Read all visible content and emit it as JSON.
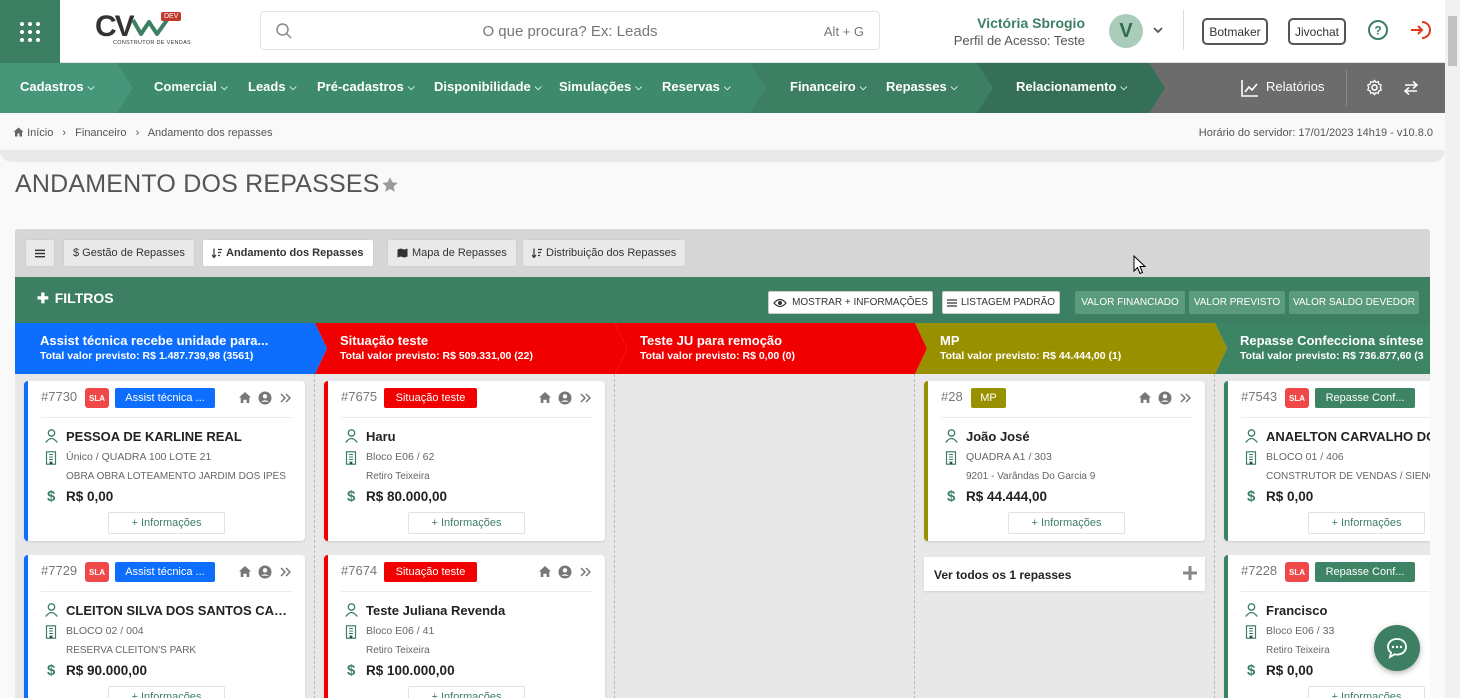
{
  "header": {
    "logo_text": "CV",
    "logo_badge": "DEV",
    "logo_subtitle": "CONSTRUTOR DE VENDAS",
    "search_placeholder": "O que procura? Ex: Leads",
    "search_shortcut": "Alt + G",
    "user_name": "Victória Sbrogio",
    "user_profile": "Perfil de Acesso: Teste",
    "avatar_initial": "V",
    "botmaker_label": "Botmaker",
    "jivochat_label": "Jivochat"
  },
  "nav": {
    "items": [
      "Cadastros",
      "Comercial",
      "Leads",
      "Pré-cadastros",
      "Disponibilidade",
      "Simulações",
      "Reservas",
      "Financeiro",
      "Repasses",
      "Relacionamento"
    ],
    "reports_label": "Relatórios"
  },
  "breadcrumb": {
    "items": [
      "Início",
      "Financeiro",
      "Andamento dos repasses"
    ]
  },
  "server_time": "Horário do servidor: 17/01/2023 14h19 - v10.8.0",
  "page_title": "ANDAMENTO DOS REPASSES",
  "tabs": [
    {
      "label": "$ Gestão de Repasses"
    },
    {
      "label": "Andamento dos Repasses"
    },
    {
      "label": "Mapa de Repasses"
    },
    {
      "label": "Distribuição dos Repasses"
    }
  ],
  "filters": {
    "label": "FILTROS",
    "show_more": "MOSTRAR + INFORMAÇÕES",
    "default_list": "LISTAGEM PADRÃO",
    "valor_financiado": "VALOR FINANCIADO",
    "valor_previsto": "VALOR PREVISTO",
    "valor_saldo": "VALOR SALDO DEVEDOR"
  },
  "columns": [
    {
      "title": "Assist técnica recebe unidade para...",
      "total": "Total valor previsto: R$ 1.487.739,98 (3561)",
      "color": "#0d6efd"
    },
    {
      "title": "Situação teste",
      "total": "Total valor previsto: R$ 509.331,00 (22)",
      "color": "#f00000"
    },
    {
      "title": "Teste JU para remoção",
      "total": "Total valor previsto: R$ 0,00 (0)",
      "color": "#f00000"
    },
    {
      "title": "MP",
      "total": "Total valor previsto: R$ 44.444,00 (1)",
      "color": "#999000"
    },
    {
      "title": "Repasse Confecciona síntese",
      "total": "Total valor previsto: R$ 736.877,60 (3",
      "color": "#3d8464"
    }
  ],
  "cards": [
    {
      "id": "#7730",
      "sla": "SLA",
      "badge": "Assist técnica ...",
      "name": "PESSOA DE KARLINE REAL",
      "unit": "Único / QUADRA 100 LOTE 21",
      "project": "OBRA OBRA LOTEAMENTO JARDIM DOS IPÊS",
      "value": "R$ 0,00",
      "more": "+ Informações"
    },
    {
      "id": "#7729",
      "sla": "SLA",
      "badge": "Assist técnica ...",
      "name": "CLEITON SILVA DOS SANTOS CARDOSO",
      "unit": "BLOCO 02 / 004",
      "project": "RESERVA CLEITON'S PARK",
      "value": "R$ 90.000,00",
      "more": "+ Informações"
    },
    {
      "id": "#7675",
      "badge": "Situação teste",
      "name": "Haru",
      "unit": "Bloco E06 / 62",
      "project": "Retiro Teixeira",
      "value": "R$ 80.000,00",
      "more": "+ Informações"
    },
    {
      "id": "#7674",
      "badge": "Situação teste",
      "name": "Teste Juliana Revenda",
      "unit": "Bloco E06 / 41",
      "project": "Retiro Teixeira",
      "value": "R$ 100.000,00",
      "more": "+ Informações"
    },
    {
      "id": "#28",
      "badge": "MP",
      "name": "João José",
      "unit": "QUADRA A1 / 303",
      "project": "9201 - Varândas Do Garcia 9",
      "value": "R$ 44.444,00",
      "more": "+ Informações"
    },
    {
      "id": "#7543",
      "sla": "SLA",
      "badge": "Repasse Conf...",
      "name": "ANAELTON CARVALHO DOS SANTOS",
      "unit": "BLOCO 01 / 406",
      "project": "CONSTRUTOR DE VENDAS / SIENGE",
      "value": "R$ 0,00",
      "more": "+ Informações"
    },
    {
      "id": "#7228",
      "sla": "SLA",
      "badge": "Repasse Conf...",
      "name": "Francisco",
      "unit": "Bloco E06 / 33",
      "project": "Retiro Teixeira",
      "value": "R$ 0,00",
      "more": "+ Informações"
    }
  ],
  "see_all": "Ver todos os 1 repasses"
}
